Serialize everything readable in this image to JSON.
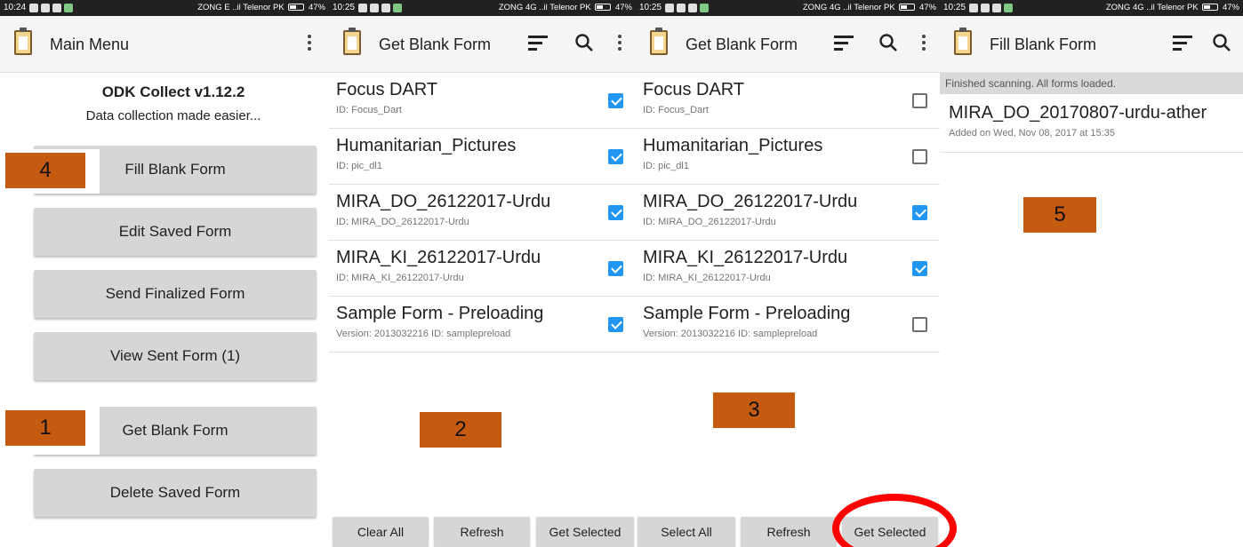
{
  "status": {
    "p1": {
      "time": "10:24",
      "carrier": "ZONG E ..il Telenor PK",
      "battery": "47%"
    },
    "p2": {
      "time": "10:25",
      "carrier": "ZONG 4G ..il Telenor PK",
      "battery": "47%"
    },
    "p3": {
      "time": "10:25",
      "carrier": "ZONG 4G ..il Telenor PK",
      "battery": "47%"
    },
    "p4": {
      "time": "10:25",
      "carrier": "ZONG 4G ..il Telenor PK",
      "battery": "47%"
    }
  },
  "main_menu": {
    "title": "Main Menu",
    "app_name": "ODK Collect v1.12.2",
    "tagline": "Data collection made easier...",
    "buttons": [
      "Fill Blank Form",
      "Edit Saved Form",
      "Send Finalized Form",
      "View Sent Form (1)",
      "Get Blank Form",
      "Delete Saved Form"
    ]
  },
  "get_blank_form_1": {
    "title": "Get Blank Form",
    "forms": [
      {
        "name": "Focus DART",
        "sub": "ID: Focus_Dart",
        "checked": true
      },
      {
        "name": "Humanitarian_Pictures",
        "sub": "ID: pic_dl1",
        "checked": true
      },
      {
        "name": "MIRA_DO_26122017-Urdu",
        "sub": "ID: MIRA_DO_26122017-Urdu",
        "checked": true
      },
      {
        "name": "MIRA_KI_26122017-Urdu",
        "sub": "ID: MIRA_KI_26122017-Urdu",
        "checked": true
      },
      {
        "name": "Sample Form - Preloading",
        "sub": "Version: 2013032216 ID: samplepreload",
        "checked": true
      }
    ],
    "buttons": [
      "Clear All",
      "Refresh",
      "Get Selected"
    ]
  },
  "get_blank_form_2": {
    "title": "Get Blank Form",
    "forms": [
      {
        "name": "Focus DART",
        "sub": "ID: Focus_Dart",
        "checked": false
      },
      {
        "name": "Humanitarian_Pictures",
        "sub": "ID: pic_dl1",
        "checked": false
      },
      {
        "name": "MIRA_DO_26122017-Urdu",
        "sub": "ID: MIRA_DO_26122017-Urdu",
        "checked": true
      },
      {
        "name": "MIRA_KI_26122017-Urdu",
        "sub": "ID: MIRA_KI_26122017-Urdu",
        "checked": true
      },
      {
        "name": "Sample Form - Preloading",
        "sub": "Version: 2013032216 ID: samplepreload",
        "checked": false
      }
    ],
    "buttons": [
      "Select All",
      "Refresh",
      "Get Selected"
    ]
  },
  "fill_blank_form": {
    "title": "Fill Blank Form",
    "scan_message": "Finished scanning. All forms loaded.",
    "form_name": "MIRA_DO_20170807-urdu-ather",
    "form_added": "Added on Wed, Nov 08, 2017 at 15:35"
  },
  "step_tags": [
    "1",
    "2",
    "3",
    "4",
    "5"
  ],
  "colors": {
    "tag": "#c55a11",
    "checkbox": "#2196f3",
    "highlight_ring": "#ff0000"
  },
  "icons": [
    "clipboard-icon",
    "overflow-menu-icon",
    "sort-icon",
    "search-icon",
    "checkbox-icon"
  ]
}
